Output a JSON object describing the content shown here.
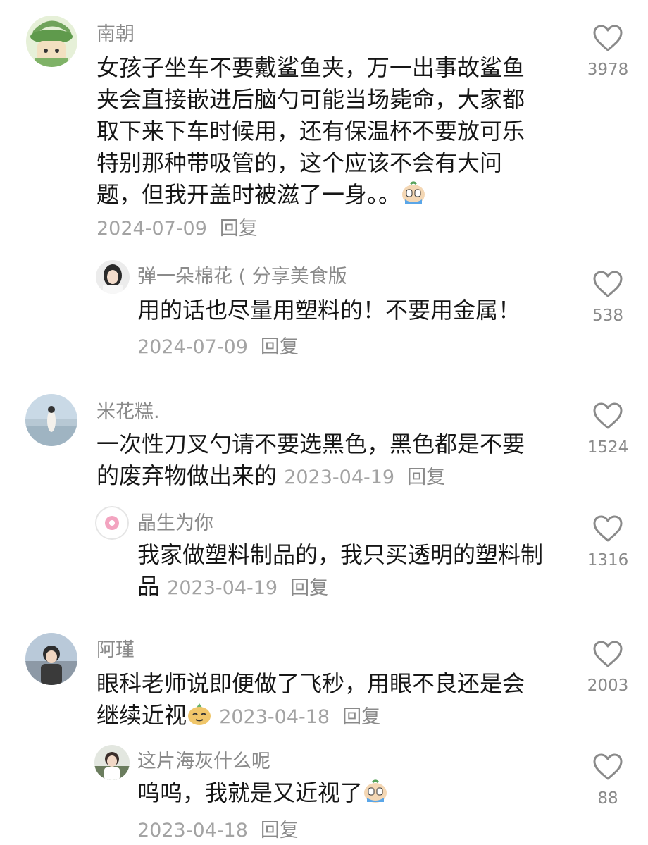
{
  "comments": [
    {
      "user": "南朝",
      "lines": [
        "女孩子坐车不要戴鲨鱼夹，万一出事故鲨鱼",
        "夹会直接嵌进后脑勺可能当场毙命，大家都",
        "取下来下车时候用，还有保温杯不要放可乐",
        "特别那种带吸管的，这个应该不会有大问",
        "题，但我开盖时被滋了一身。。"
      ],
      "emoji": "crying-face-emoji",
      "date": "2024-07-09",
      "reply_label": "回复",
      "likes": "3978"
    },
    {
      "user": "弹一朵棉花 ( 分享美食版",
      "lines": [
        "用的话也尽量用塑料的！不要用金属！"
      ],
      "date": "2024-07-09",
      "reply_label": "回复",
      "likes": "538"
    },
    {
      "user": "米花糕.",
      "lines": [
        "一次性刀叉勺请不要选黑色，黑色都是不要",
        "的废弃物做出来的"
      ],
      "date": "2023-04-19",
      "reply_label": "回复",
      "likes": "1524"
    },
    {
      "user": "晶生为你",
      "lines": [
        "我家做塑料制品的，我只买透明的塑料制",
        "品"
      ],
      "date": "2023-04-19",
      "reply_label": "回复",
      "likes": "1316"
    },
    {
      "user": "阿瑾",
      "lines": [
        "眼科老师说即便做了飞秒，用眼不良还是会",
        "继续近视"
      ],
      "emoji": "smug-face-emoji",
      "date": "2023-04-18",
      "reply_label": "回复",
      "likes": "2003"
    },
    {
      "user": "这片海灰什么呢",
      "lines": [
        "呜呜，我就是又近视了"
      ],
      "emoji": "crying-face-emoji",
      "date": "2023-04-18",
      "reply_label": "回复",
      "likes": "88"
    }
  ],
  "icons": {
    "like": "heart-outline-icon"
  },
  "colors": {
    "text": "#161616",
    "muted": "#8a8a8a",
    "date": "#a3a3a3",
    "background": "#ffffff"
  }
}
